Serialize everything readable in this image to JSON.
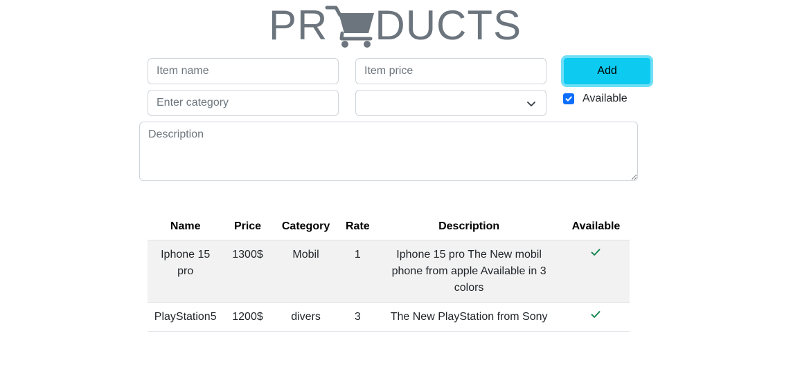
{
  "header": {
    "title_left": "PR",
    "title_right": "DUCTS",
    "logo_icon": "shopping-cart-icon",
    "logo_color": "#6c757d"
  },
  "form": {
    "name_placeholder": "Item name",
    "price_placeholder": "Item price",
    "category_placeholder": "Enter category",
    "select_value": "",
    "description_placeholder": "Description",
    "add_label": "Add",
    "available_label": "Available",
    "available_checked": true,
    "add_color": "#0dcaf0",
    "checkbox_color": "#0d6efd"
  },
  "table": {
    "headers": [
      "Name",
      "Price",
      "Category",
      "Rate",
      "Description",
      "Available"
    ],
    "rows": [
      {
        "name": "Iphone 15 pro",
        "price": "1300$",
        "category": "Mobil",
        "rate": "1",
        "description": "Iphone 15 pro The New mobil phone from apple Available in 3 colors",
        "available": true
      },
      {
        "name": "PlayStation5",
        "price": "1200$",
        "category": "divers",
        "rate": "3",
        "description": "The New PlayStation from Sony",
        "available": true
      }
    ],
    "check_color": "#198754"
  }
}
